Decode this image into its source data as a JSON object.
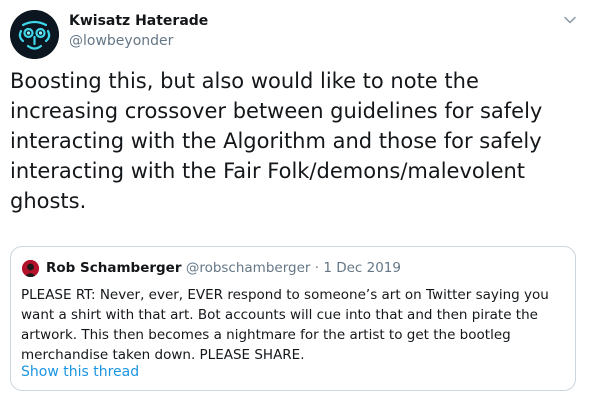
{
  "author": {
    "display_name": "Kwisatz Haterade",
    "handle": "@lowbeyonder"
  },
  "tweet": {
    "text": "Boosting this, but also would like to note the\nincreasing crossover between guidelines for safely\ninteracting with the Algorithm and those for safely\ninteracting with the Fair Folk/demons/malevolent\nghosts."
  },
  "quoted": {
    "author_name": "Rob Schamberger",
    "handle": "@robschamberger",
    "separator": " · ",
    "date": "1 Dec 2019",
    "text": "PLEASE RT: Never, ever, EVER respond to someone’s art on Twitter saying you\nwant a shirt with that art. Bot accounts will cue into that and then pirate the\nartwork. This then becomes a nightmare for the artist to get the bootleg\nmerchandise taken down. PLEASE SHARE.",
    "show_thread_label": "Show this thread"
  },
  "icons": {
    "avatar": "glowing-cyan-mask-avatar",
    "menu": "chevron-down-icon",
    "quoted_avatar": "red-portrait-avatar"
  },
  "colors": {
    "primary_text": "#14171a",
    "secondary_text": "#657786",
    "link": "#1b95e0",
    "border": "#ccd6dd"
  }
}
